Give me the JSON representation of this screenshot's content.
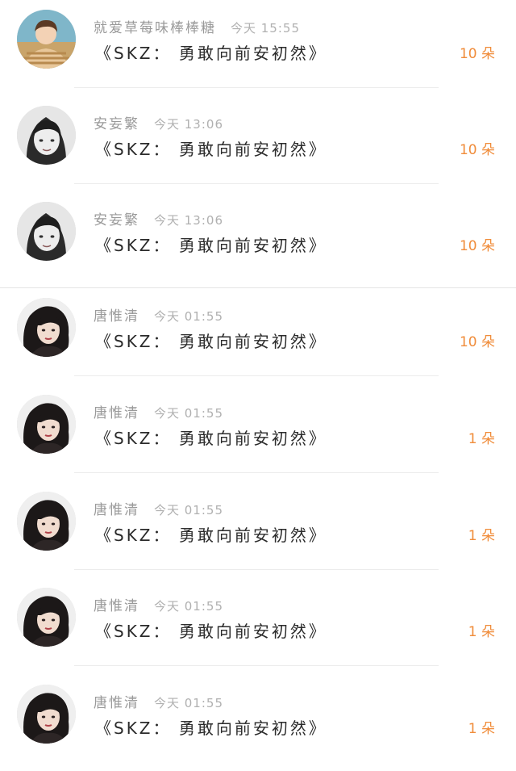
{
  "messages": [
    {
      "name": "就爱草莓味棒棒糖",
      "time": "今天 15:55",
      "title": "《SKZ： 勇敢向前安初然》",
      "count": "10 朵",
      "avatar": "boy-striped-shirt-avatar"
    },
    {
      "name": "安妄繁",
      "time": "今天 13:06",
      "title": "《SKZ： 勇敢向前安初然》",
      "count": "10 朵",
      "avatar": "girl-bangs-grayscale-avatar"
    },
    {
      "name": "安妄繁",
      "time": "今天 13:06",
      "title": "《SKZ： 勇敢向前安初然》",
      "count": "10 朵",
      "avatar": "girl-bangs-grayscale-avatar"
    },
    {
      "name": "唐惟清",
      "time": "今天 01:55",
      "title": "《SKZ： 勇敢向前安初然》",
      "count": "10 朵",
      "avatar": "woman-wavy-hair-avatar"
    },
    {
      "name": "唐惟清",
      "time": "今天 01:55",
      "title": "《SKZ： 勇敢向前安初然》",
      "count": "1 朵",
      "avatar": "woman-wavy-hair-avatar"
    },
    {
      "name": "唐惟清",
      "time": "今天 01:55",
      "title": "《SKZ： 勇敢向前安初然》",
      "count": "1 朵",
      "avatar": "woman-wavy-hair-avatar"
    },
    {
      "name": "唐惟清",
      "time": "今天 01:55",
      "title": "《SKZ： 勇敢向前安初然》",
      "count": "1 朵",
      "avatar": "woman-wavy-hair-avatar"
    },
    {
      "name": "唐惟清",
      "time": "今天 01:55",
      "title": "《SKZ： 勇敢向前安初然》",
      "count": "1 朵",
      "avatar": "woman-wavy-hair-avatar"
    }
  ],
  "colors": {
    "count": "#f08c3a",
    "name": "#9a9a9a",
    "title": "#2b2b2b",
    "divider": "#ececec"
  }
}
